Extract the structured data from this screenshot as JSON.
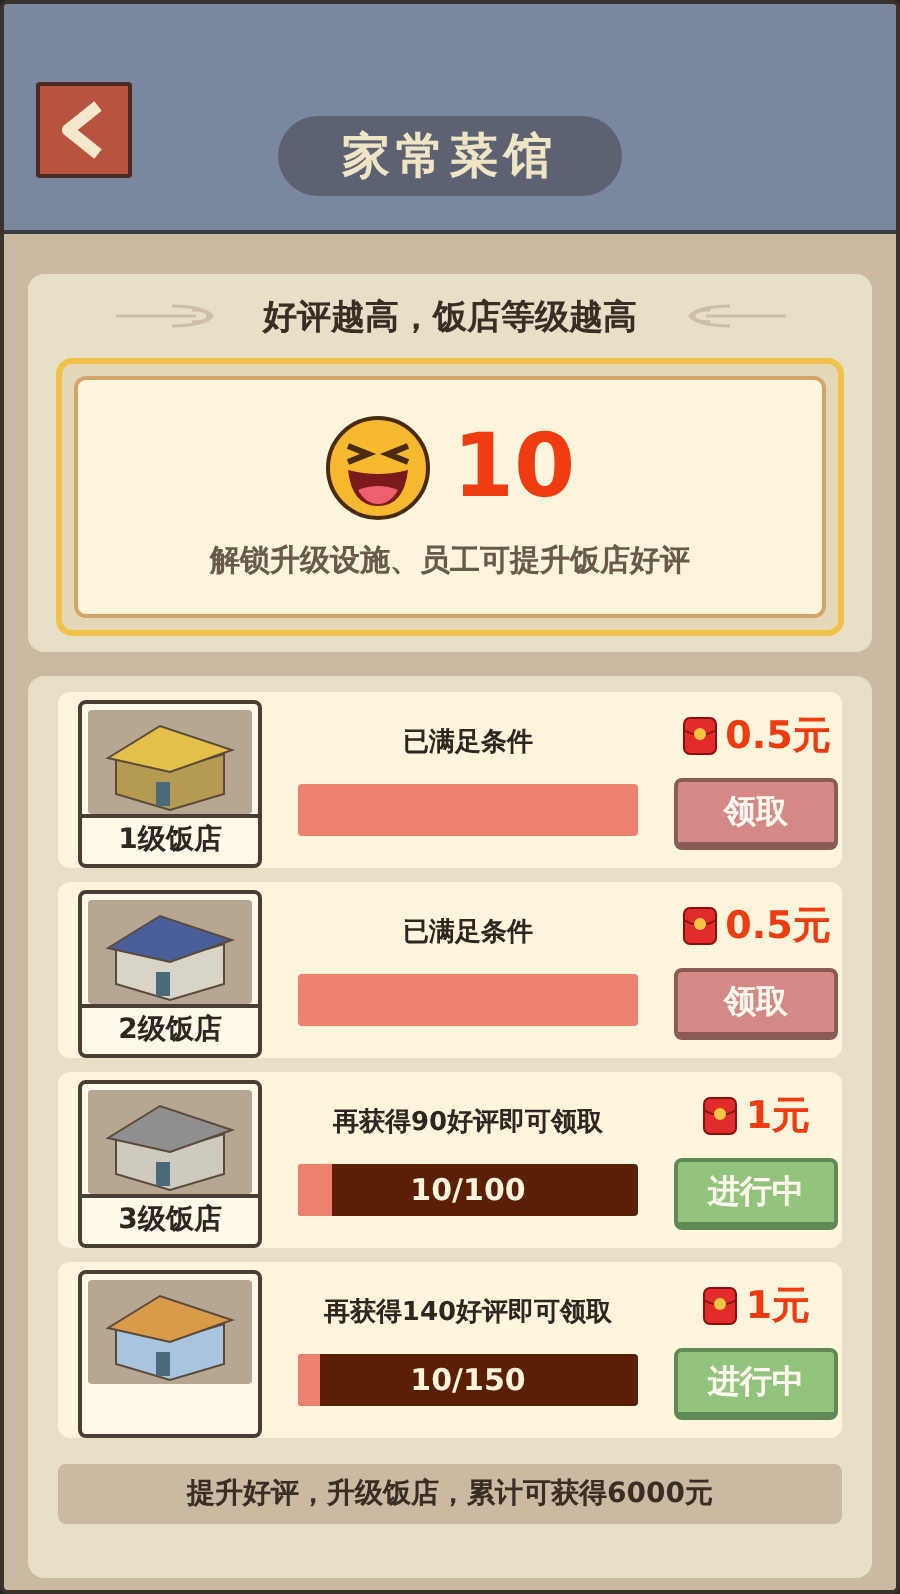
{
  "header": {
    "title": "家常菜馆"
  },
  "summary": {
    "heading": "好评越高，饭店等级越高",
    "score": "10",
    "hint": "解锁升级设施、员工可提升饭店好评"
  },
  "levels": [
    {
      "label": "1级饭店",
      "condition": "已满足条件",
      "level": 1,
      "reward": "0.5元",
      "button": {
        "label": "领取",
        "kind": "claim"
      }
    },
    {
      "label": "2级饭店",
      "condition": "已满足条件",
      "level": 1,
      "reward": "0.5元",
      "button": {
        "label": "领取",
        "kind": "claim"
      }
    },
    {
      "label": "3级饭店",
      "condition": "再获得90好评即可领取",
      "level": 0.1,
      "progress": "10/100",
      "reward": "1元",
      "button": {
        "label": "进行中",
        "kind": "in_progress"
      }
    },
    {
      "condition": "再获得140好评即可领取",
      "level": 0.067,
      "progress": "10/150",
      "reward": "1元",
      "button": {
        "label": "进行中",
        "kind": "in_progress"
      }
    }
  ],
  "footer": "提升好评，升级饭店，累计可获得6000元"
}
